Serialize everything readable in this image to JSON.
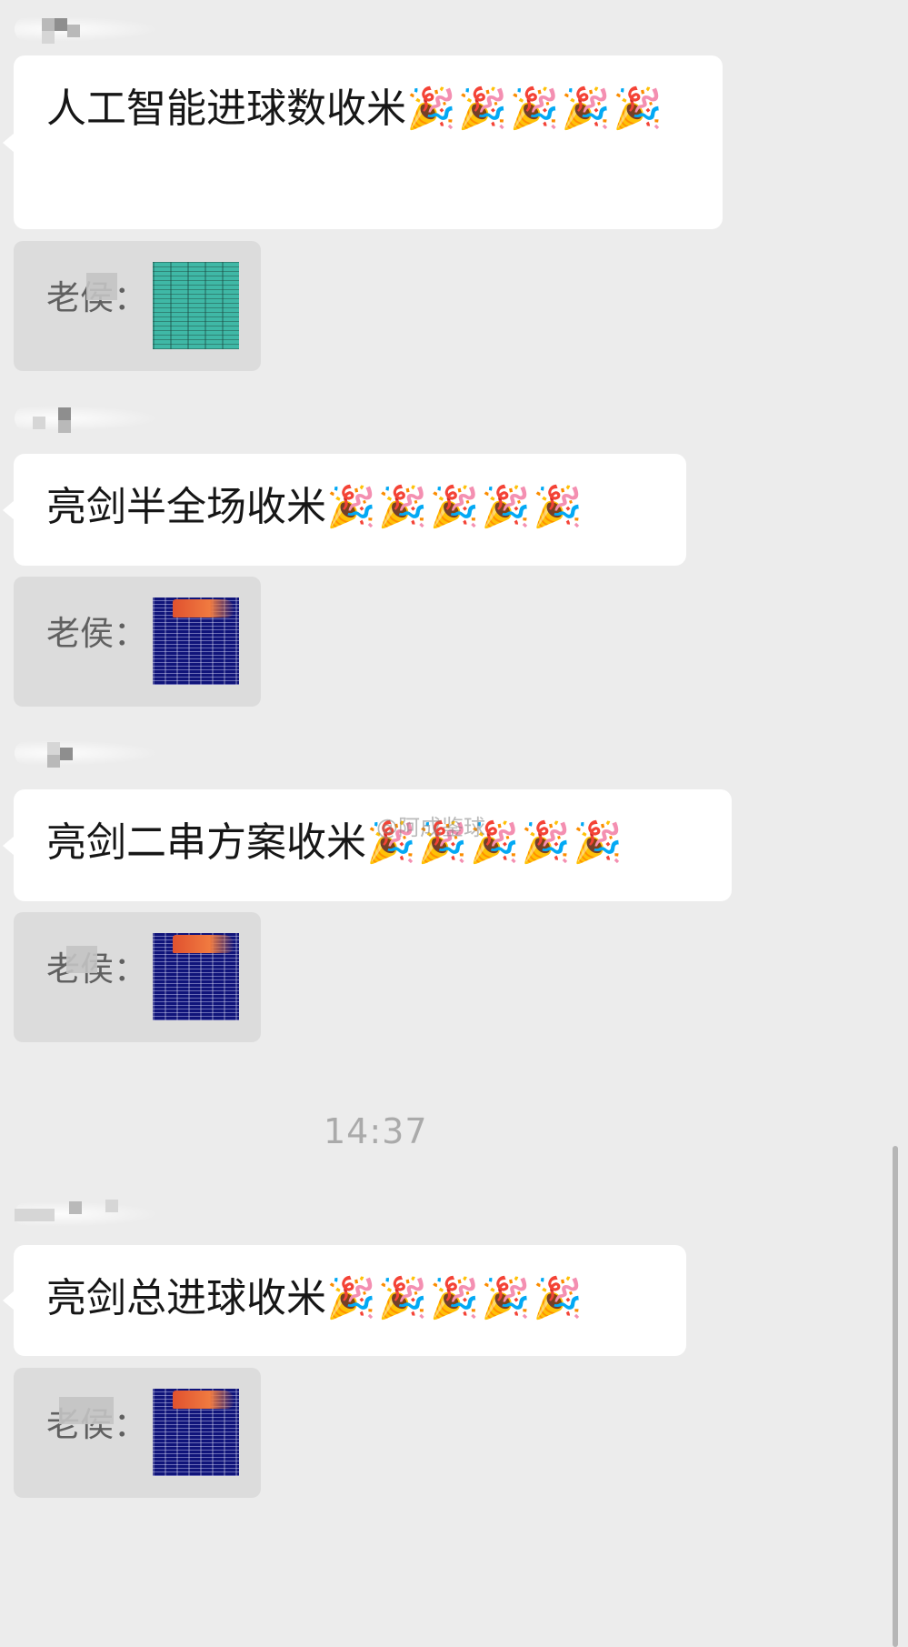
{
  "messages": [
    {
      "text": "人工智能进球数收米",
      "emojis": "🎉🎉🎉🎉🎉",
      "quote_label": "老侯："
    },
    {
      "text": "亮剑半全场收米",
      "emojis": "🎉🎉🎉🎉🎉",
      "quote_label": "老侯："
    },
    {
      "text": "亮剑二串方案收米",
      "emojis": "🎉🎉🎉🎉🎉",
      "quote_label": "老侯："
    },
    {
      "text": "亮剑总进球收米",
      "emojis": "🎉🎉🎉🎉🎉",
      "quote_label": "老侯："
    }
  ],
  "timestamp": "14:37",
  "watermark": "@阿成鉴球",
  "icons": {
    "emoji": "party-popper",
    "thumbnail_teal": "spreadsheet-image",
    "thumbnail_navy": "spreadsheet-image"
  },
  "colors": {
    "background": "#ececec",
    "bubble": "#ffffff",
    "quote": "#dcdcdc",
    "thumb_teal": "#3fb8a6",
    "thumb_navy": "#10147a",
    "thumb_header": "#e0522f"
  }
}
